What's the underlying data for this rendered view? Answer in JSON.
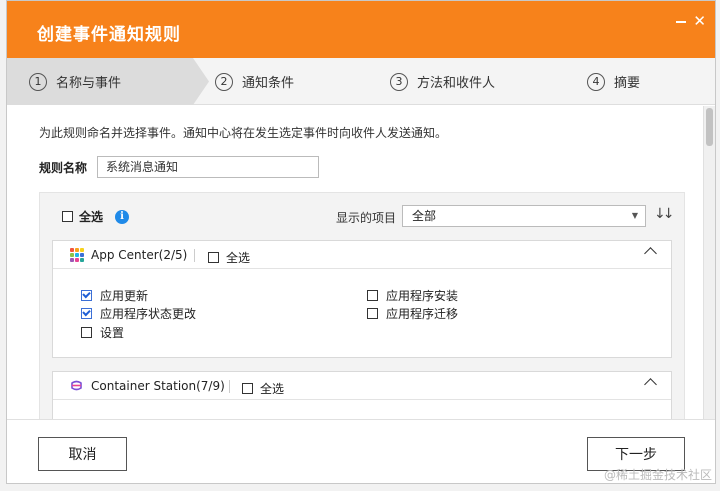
{
  "dialog": {
    "title": "创建事件通知规则"
  },
  "steps": [
    {
      "num": "1",
      "label": "名称与事件"
    },
    {
      "num": "2",
      "label": "通知条件"
    },
    {
      "num": "3",
      "label": "方法和收件人"
    },
    {
      "num": "4",
      "label": "摘要"
    }
  ],
  "description": "为此规则命名并选择事件。通知中心将在发生选定事件时向收件人发送通知。",
  "rule_name": {
    "label": "规则名称",
    "value": "系统消息通知"
  },
  "filter": {
    "select_all_label": "全选",
    "select_all_checked": false,
    "show_items_label": "显示的项目",
    "show_items_value": "全部"
  },
  "cards": [
    {
      "title": "App Center(2/5)",
      "select_all_label": "全选",
      "events": [
        {
          "label": "应用更新",
          "checked": true
        },
        {
          "label": "应用程序状态更改",
          "checked": true
        },
        {
          "label": "设置",
          "checked": false
        },
        {
          "label": "应用程序安装",
          "checked": false
        },
        {
          "label": "应用程序迁移",
          "checked": false
        }
      ]
    },
    {
      "title": "Container Station(7/9)",
      "select_all_label": "全选"
    }
  ],
  "footer": {
    "cancel_label": "取消",
    "next_label": "下一步"
  },
  "watermark": "@稀土掘金技术社区",
  "colors": {
    "brand": "#f7821b",
    "info": "#1f8ae8",
    "check": "#1f5fd6"
  }
}
